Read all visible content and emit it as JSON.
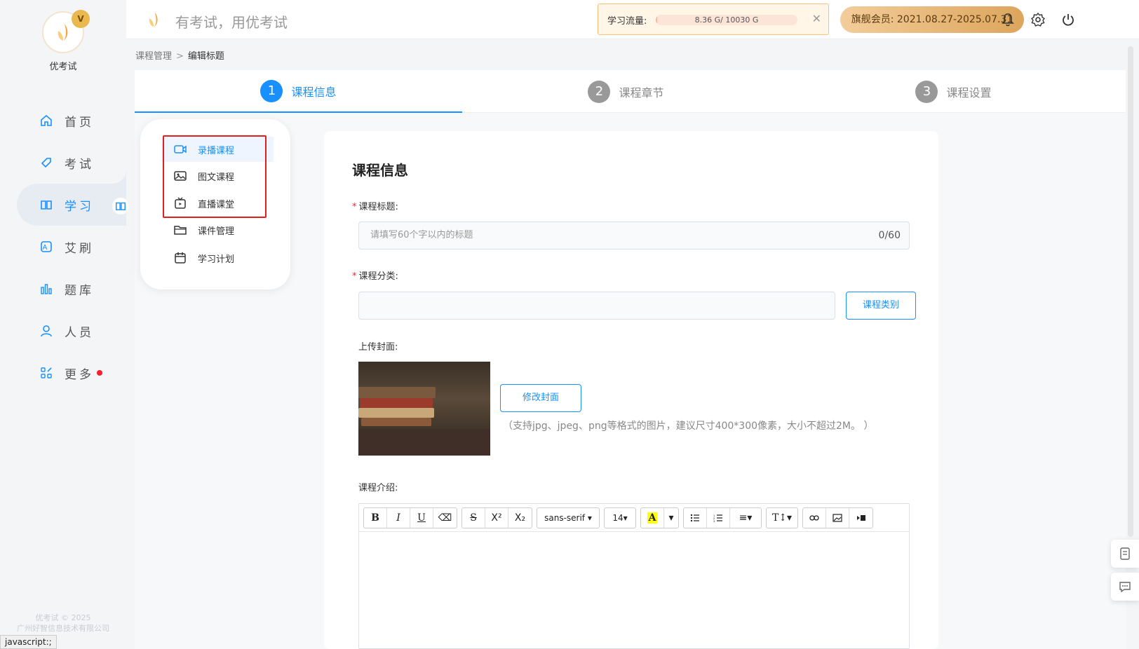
{
  "brand": {
    "name": "优考试",
    "crown": "V",
    "slogan": "有考试，用优考试"
  },
  "nav": [
    {
      "label": "首页",
      "icon": "home-icon"
    },
    {
      "label": "考试",
      "icon": "tag-icon"
    },
    {
      "label": "学习",
      "icon": "book-icon",
      "active": true
    },
    {
      "label": "艾刷",
      "icon": "letter-a-icon"
    },
    {
      "label": "题库",
      "icon": "bar-chart-icon"
    },
    {
      "label": "人员",
      "icon": "user-icon"
    },
    {
      "label": "更多",
      "icon": "apps-icon",
      "badge": true
    }
  ],
  "footer": {
    "copyright": "优考试 © 2025",
    "company": "广州好智信息技术有限公司",
    "status_link": "javascript:;"
  },
  "header": {
    "traffic": {
      "label": "学习流量:",
      "value": "8.36 G/ 10030 G",
      "used_fraction": 0.0008
    },
    "member": "旗舰会员: 2021.08.27-2025.07.31",
    "colors": {
      "accent": "#1890ff",
      "member_gradient": "#dca55c"
    }
  },
  "breadcrumb": {
    "parent": "课程管理",
    "separator": ">",
    "current": "编辑标题"
  },
  "steps": [
    {
      "num": "1",
      "label": "课程信息",
      "active": true
    },
    {
      "num": "2",
      "label": "课程章节"
    },
    {
      "num": "3",
      "label": "课程设置"
    }
  ],
  "dropdown": [
    {
      "label": "录播课程",
      "icon": "video-icon",
      "active": true
    },
    {
      "label": "图文课程",
      "icon": "image-icon"
    },
    {
      "label": "直播课堂",
      "icon": "live-tv-icon"
    },
    {
      "label": "课件管理",
      "icon": "folder-icon"
    },
    {
      "label": "学习计划",
      "icon": "calendar-icon"
    }
  ],
  "form": {
    "title": "课程信息",
    "course_title": {
      "label": "课程标题:",
      "placeholder": "请填写60个字以内的标题",
      "count": "0/60"
    },
    "category": {
      "label": "课程分类:",
      "button": "课程类别"
    },
    "cover": {
      "label": "上传封面:",
      "button": "修改封面",
      "hint": "（支持jpg、jpeg、png等格式的图片，建议尺寸400*300像素，大小不超过2M。 ）"
    },
    "intro": {
      "label": "课程介绍:"
    }
  },
  "editor_toolbar": {
    "bold": "B",
    "italic": "I",
    "underline": "U",
    "eraser": "⌫",
    "strike": "S",
    "sup": "X²",
    "sub": "X₂",
    "font": "sans-serif ▾",
    "size": "14▾",
    "color": "A",
    "color_caret": "▾",
    "align": "≡▾",
    "text_size": "T↕▾"
  }
}
